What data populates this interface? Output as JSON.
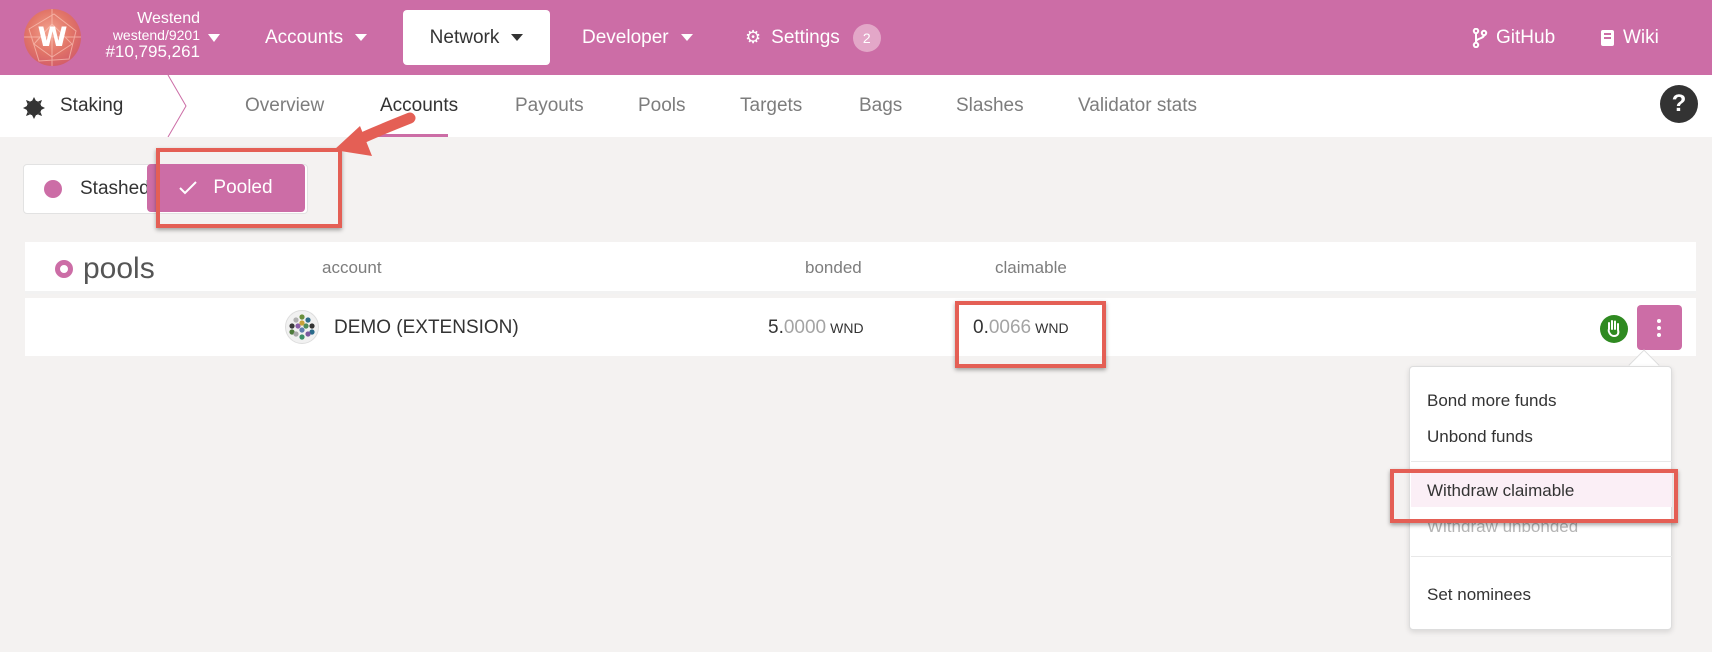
{
  "topbar": {
    "chain_name": "Westend",
    "chain_runtime": "westend/9201",
    "block_number": "#10,795,261",
    "logo_letter": "W",
    "nav": {
      "accounts": "Accounts",
      "network": "Network",
      "developer": "Developer",
      "settings": "Settings",
      "settings_badge": "2",
      "github": "GitHub",
      "wiki": "Wiki"
    }
  },
  "subbar": {
    "section": "Staking",
    "tabs": [
      "Overview",
      "Accounts",
      "Payouts",
      "Pools",
      "Targets",
      "Bags",
      "Slashes",
      "Validator stats"
    ],
    "active_tab": "Accounts",
    "help": "?"
  },
  "toggle": {
    "stashed": "Stashed",
    "pooled": "Pooled",
    "selected": "Pooled"
  },
  "table": {
    "title": "pools",
    "headers": {
      "account": "account",
      "bonded": "bonded",
      "claimable": "claimable"
    },
    "rows": [
      {
        "account": "DEMO (EXTENSION)",
        "bonded_int": "5.",
        "bonded_frac": "0000",
        "bonded_unit": "WND",
        "claimable_int": "0.",
        "claimable_frac": "0066",
        "claimable_unit": "WND"
      }
    ]
  },
  "menu": {
    "items": [
      "Bond more funds",
      "Unbond funds",
      "Withdraw claimable",
      "Withdraw unbonded",
      "Set nominees"
    ],
    "highlighted": "Withdraw claimable",
    "disabled": [
      "Withdraw unbonded"
    ]
  },
  "colors": {
    "brand": "#cc6da6",
    "annotation": "#e45f55",
    "status_ok": "#2f8a21"
  }
}
